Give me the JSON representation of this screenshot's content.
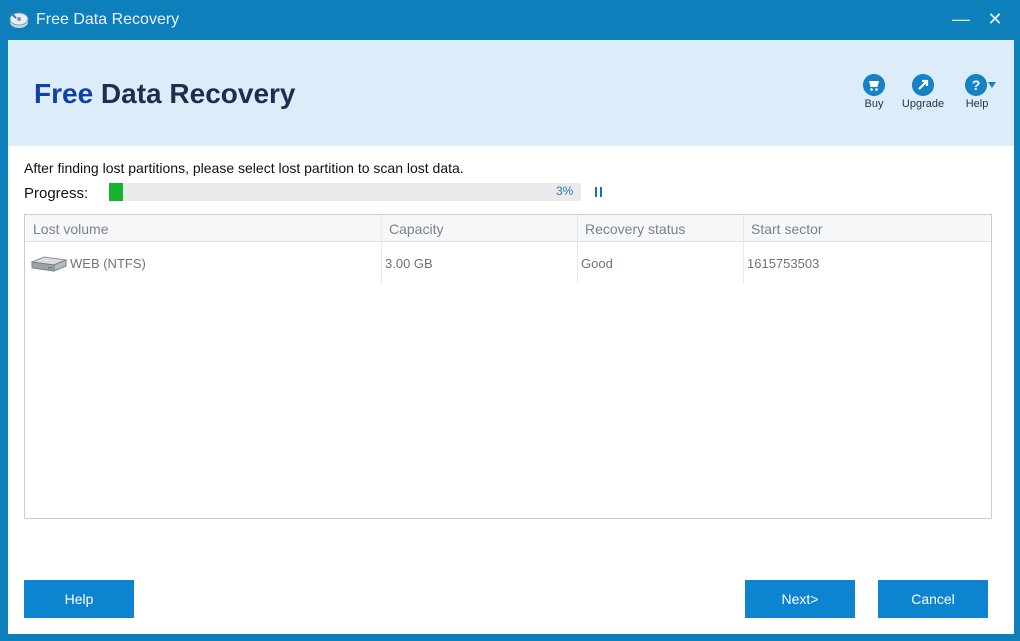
{
  "window": {
    "title": "Free Data Recovery",
    "app_icon": "recovery-app-icon",
    "controls": {
      "minimize": "—",
      "close": "✕"
    }
  },
  "header": {
    "brand_first": "Free",
    "brand_rest": " Data Recovery",
    "tools": [
      {
        "label": "Buy",
        "icon": "cart-icon"
      },
      {
        "label": "Upgrade",
        "icon": "upgrade-icon"
      },
      {
        "label": "Help",
        "icon": "help-icon"
      }
    ]
  },
  "scan": {
    "instruction": "After finding lost partitions, please select lost partition to scan lost data.",
    "progress_label": "Progress:",
    "progress_text": "3%",
    "progress_value": 3
  },
  "table": {
    "columns": [
      "Lost volume",
      "Capacity",
      "Recovery status",
      "Start sector"
    ],
    "rows": [
      {
        "volume": "WEB (NTFS)",
        "capacity": "3.00 GB",
        "status": "Good",
        "start_sector": "1615753503",
        "icon": "hard-drive-icon"
      }
    ]
  },
  "buttons": {
    "help": "Help",
    "next": "Next>",
    "cancel": "Cancel"
  },
  "colors": {
    "titlebar": "#0d7fba",
    "header_bg": "#dcecf8",
    "accent": "#0d84cf",
    "progress": "#16b331"
  }
}
